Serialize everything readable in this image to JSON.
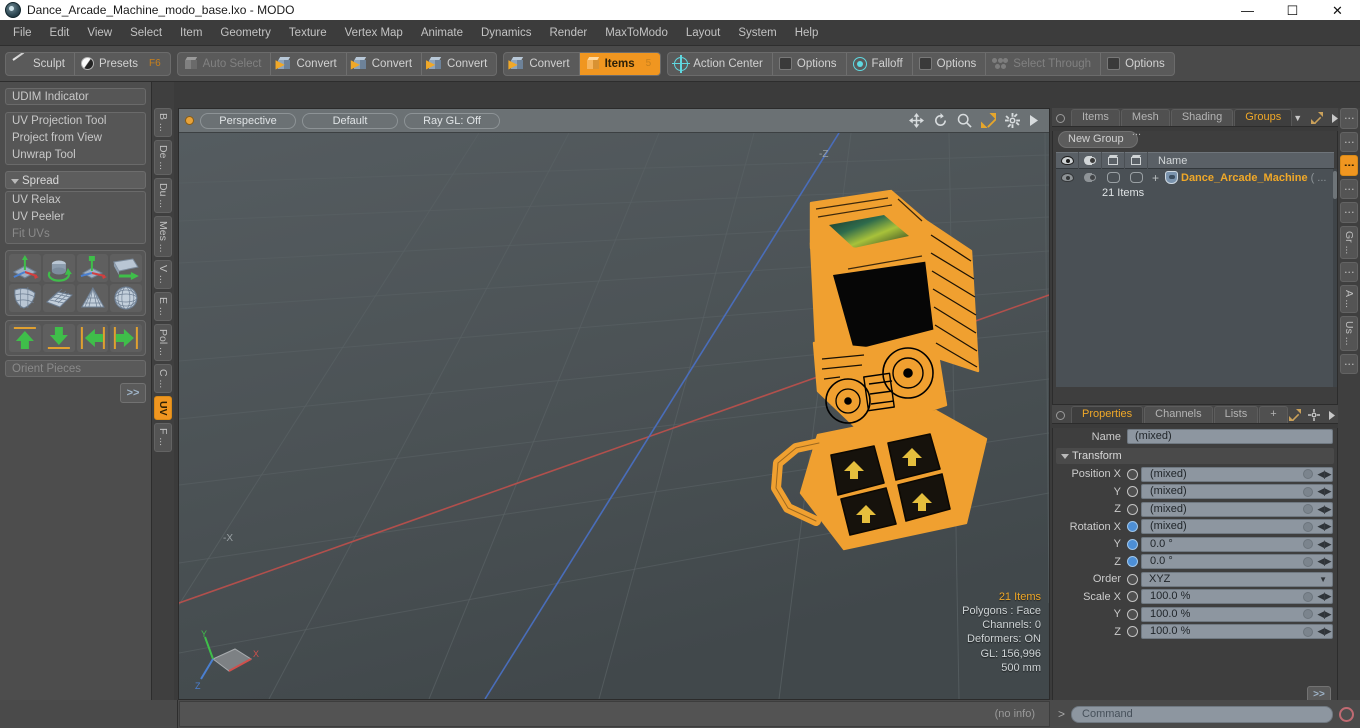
{
  "titlebar": {
    "title": "Dance_Arcade_Machine_modo_base.lxo - MODO",
    "minimize": "—",
    "maximize": "☐",
    "close": "✕"
  },
  "menubar": {
    "items": [
      "File",
      "Edit",
      "View",
      "Select",
      "Item",
      "Geometry",
      "Texture",
      "Vertex Map",
      "Animate",
      "Dynamics",
      "Render",
      "MaxToModo",
      "Layout",
      "System",
      "Help"
    ]
  },
  "toolbar": {
    "groups": [
      {
        "cells": [
          {
            "label": "Sculpt",
            "icon": "pencil-icon",
            "state": "normal",
            "badge": ""
          },
          {
            "label": "Presets",
            "icon": "sphere-icon",
            "state": "normal",
            "badge": "F6"
          }
        ]
      },
      {
        "cells": [
          {
            "label": "Auto Select",
            "icon": "cube-gray-icon",
            "state": "dim",
            "badge": ""
          },
          {
            "label": "Convert",
            "icon": "cube-convert-icon",
            "state": "normal",
            "badge": ""
          },
          {
            "label": "Convert",
            "icon": "cube-convert-icon",
            "state": "normal",
            "badge": ""
          },
          {
            "label": "Convert",
            "icon": "cube-convert-icon",
            "state": "normal",
            "badge": ""
          }
        ]
      },
      {
        "cells": [
          {
            "label": "Convert",
            "icon": "cube-convert-icon",
            "state": "normal",
            "badge": ""
          },
          {
            "label": "Items",
            "icon": "cube-orange-icon",
            "state": "active",
            "badge": "5"
          }
        ]
      },
      {
        "cells": [
          {
            "label": "Action Center",
            "icon": "crosshair-icon",
            "state": "normal",
            "badge": ""
          },
          {
            "label": "Options",
            "icon": "options-icon",
            "state": "normal",
            "badge": ""
          },
          {
            "label": "Falloff",
            "icon": "falloff-icon",
            "state": "normal",
            "badge": ""
          },
          {
            "label": "Options",
            "icon": "options-icon",
            "state": "normal",
            "badge": ""
          },
          {
            "label": "Select Through",
            "icon": "select-through-icon",
            "state": "dim",
            "badge": ""
          },
          {
            "label": "Options",
            "icon": "options-icon",
            "state": "normal",
            "badge": ""
          }
        ]
      }
    ]
  },
  "left_panel": {
    "udim_indicator": "UDIM Indicator",
    "uv_tools": [
      "UV Projection Tool",
      "Project from View",
      "Unwrap Tool"
    ],
    "spread_header": "Spread",
    "relax_tools": [
      {
        "label": "UV Relax",
        "state": "normal"
      },
      {
        "label": "UV Peeler",
        "state": "normal"
      },
      {
        "label": "Fit UVs",
        "state": "dim"
      }
    ],
    "transform_icons": [
      "uv-transform-icon",
      "uv-rotate-icon",
      "uv-move-icon",
      "uv-flip-icon"
    ],
    "deform_icons": [
      "uv-fit-icon",
      "uv-grid-icon",
      "uv-cone-icon",
      "uv-sphere-icon"
    ],
    "align_icons": [
      "align-up-icon",
      "align-down-icon",
      "align-left-icon",
      "align-right-icon"
    ],
    "orient_pieces": "Orient Pieces",
    "more_button": ">>",
    "vtabs": [
      {
        "label": "B ...",
        "active": false
      },
      {
        "label": "De ...",
        "active": false
      },
      {
        "label": "Du ...",
        "active": false
      },
      {
        "label": "Mes ...",
        "active": false
      },
      {
        "label": "V ...",
        "active": false
      },
      {
        "label": "E ...",
        "active": false
      },
      {
        "label": "Pol ...",
        "active": false
      },
      {
        "label": "C ...",
        "active": false
      },
      {
        "label": "UV",
        "active": true
      },
      {
        "label": "F ...",
        "active": false
      }
    ]
  },
  "viewport": {
    "view_mode": "Perspective",
    "shading": "Default",
    "ray_gl": "Ray GL: Off",
    "header_icons": [
      "move-icon",
      "rotate-icon",
      "zoom-icon",
      "fit-icon",
      "gear-icon",
      "play-icon"
    ],
    "axis_labels": {
      "x": "X",
      "y": "Y",
      "z": "Z",
      "neg_x": "-X",
      "neg_z": "-Z"
    },
    "stats": {
      "items": "21 Items",
      "polygons": "Polygons : Face",
      "channels": "Channels: 0",
      "deformers": "Deformers: ON",
      "gl": "GL: 156,996",
      "grid": "500 mm"
    },
    "colors": {
      "background": "#4a5154",
      "wireframe": "#f0a030",
      "axis_x": "#c0504d",
      "axis_z": "#4a6fc0"
    }
  },
  "right_panel": {
    "top_tabs": [
      {
        "label": "Items",
        "active": false
      },
      {
        "label": "Mesh ...",
        "active": false
      },
      {
        "label": "Shading",
        "active": false
      },
      {
        "label": "Groups",
        "active": true
      }
    ],
    "top_tab_extra": "▼",
    "new_group_button": "New Group",
    "tree_header": {
      "col_icons": [
        "eye-icon",
        "mask-icon",
        "cube-outline-icon",
        "cube-solid-icon"
      ],
      "name": "Name"
    },
    "tree_rows": [
      {
        "item_name": "Dance_Arcade_Machine",
        "paren": "( ...",
        "sub_label": "21 Items",
        "expander": "+"
      }
    ],
    "bottom_tabs": [
      {
        "label": "Properties",
        "active": true
      },
      {
        "label": "Channels",
        "active": false
      },
      {
        "label": "Lists",
        "active": false
      },
      {
        "label": "+",
        "active": false
      }
    ],
    "properties": {
      "name_label": "Name",
      "name_value": "(mixed)",
      "transform_section": "Transform",
      "rows": [
        {
          "label": "Position X",
          "value": "(mixed)",
          "toggle": "off",
          "type": "field"
        },
        {
          "label": "Y",
          "value": "(mixed)",
          "toggle": "off",
          "type": "field"
        },
        {
          "label": "Z",
          "value": "(mixed)",
          "toggle": "off",
          "type": "field"
        },
        {
          "label": "Rotation X",
          "value": "(mixed)",
          "toggle": "on",
          "type": "field"
        },
        {
          "label": "Y",
          "value": "0.0 °",
          "toggle": "on",
          "type": "field"
        },
        {
          "label": "Z",
          "value": "0.0 °",
          "toggle": "on",
          "type": "field"
        },
        {
          "label": "Order",
          "value": "XYZ",
          "toggle": "off",
          "type": "select"
        },
        {
          "label": "Scale X",
          "value": "100.0 %",
          "toggle": "off",
          "type": "field"
        },
        {
          "label": "Y",
          "value": "100.0 %",
          "toggle": "off",
          "type": "field"
        },
        {
          "label": "Z",
          "value": "100.0 %",
          "toggle": "off",
          "type": "field"
        }
      ],
      "more_button": ">>"
    },
    "vtabs": [
      {
        "label": "⋮",
        "active": false
      },
      {
        "label": "⋮",
        "active": false
      },
      {
        "label": "⋮",
        "active": true
      },
      {
        "label": "⋮",
        "active": false
      },
      {
        "label": "⋮",
        "active": false
      },
      {
        "label": "Gr ...",
        "active": false
      },
      {
        "label": "⋮",
        "active": false
      },
      {
        "label": "A ...",
        "active": false
      },
      {
        "label": "Us ...",
        "active": false
      },
      {
        "label": "⋮",
        "active": false
      }
    ]
  },
  "bottom_bar": {
    "info": "(no info)",
    "command_prompt": ">",
    "command_placeholder": "Command",
    "record_icon": "record-icon"
  }
}
